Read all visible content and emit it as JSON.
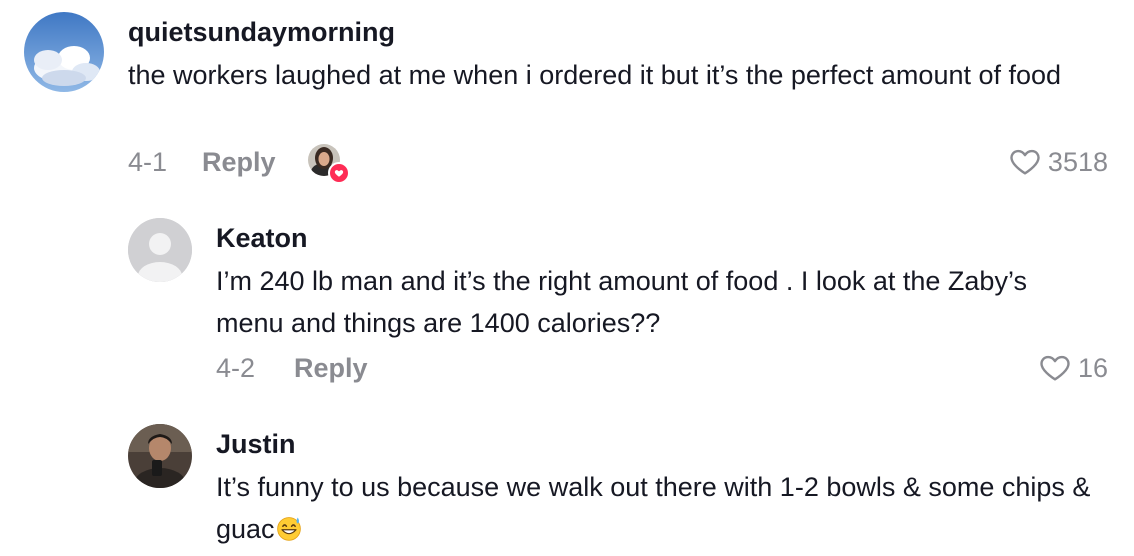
{
  "comments": [
    {
      "username": "quietsundaymorning",
      "text": "the workers laughed at me when i ordered it but it’s the perfect amount of food",
      "date": "4-1",
      "reply_label": "Reply",
      "likes": "3518",
      "creator_liked": true
    },
    {
      "username": "Keaton",
      "text": "I’m 240 lb man and it’s the right amount of food . I look at the Zaby’s menu and things are 1400 calories??",
      "date": "4-2",
      "reply_label": "Reply",
      "likes": "16"
    },
    {
      "username": "Justin",
      "text": "It’s funny to us because we walk out there with 1-2 bowls & some chips & guac",
      "emoji": "sweat-smile-emoji"
    }
  ],
  "colors": {
    "primary_text": "#161823",
    "secondary_text": "#8a8b91",
    "like_badge": "#fe2c55"
  }
}
